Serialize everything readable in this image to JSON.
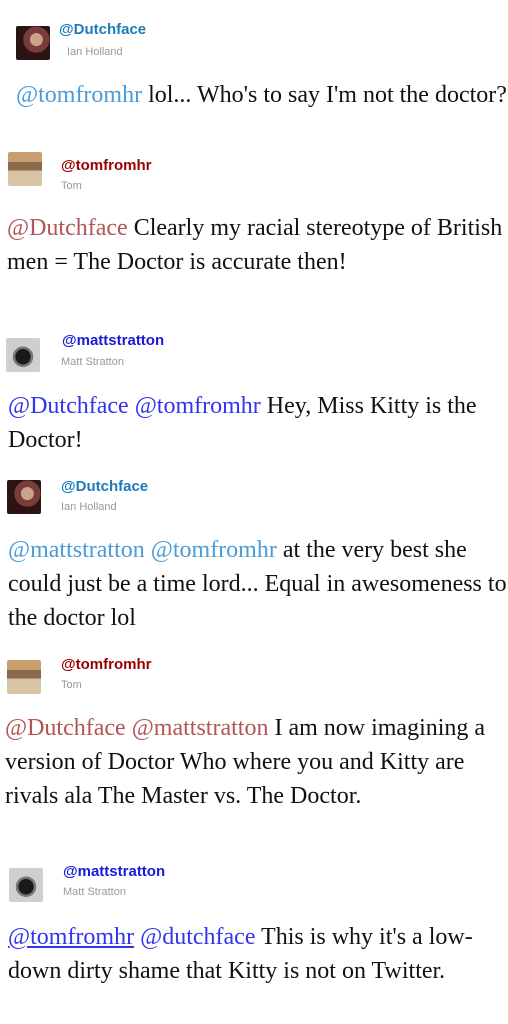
{
  "tweets": [
    {
      "handle": "@Dutchface",
      "name": "Ian Holland",
      "avatar_icon": "avatar-dutchface",
      "handle_color": "#1a7db8",
      "mention_color": "#4a9bd8",
      "parts": [
        {
          "type": "mention",
          "text": "@tomfromhr"
        },
        {
          "type": "text",
          "text": " lol... Who's to say I'm not the doctor?"
        }
      ]
    },
    {
      "handle": "@tomfromhr",
      "name": "Tom",
      "avatar_icon": "avatar-tomfromhr",
      "handle_color": "#990000",
      "mention_color": "#b35555",
      "parts": [
        {
          "type": "mention",
          "text": "@Dutchface"
        },
        {
          "type": "text",
          "text": " Clearly my racial stereotype of British men = The Doctor is accurate then!"
        }
      ]
    },
    {
      "handle": "@mattstratton",
      "name": "Matt Stratton",
      "avatar_icon": "avatar-mattstratton",
      "handle_color": "#1a1ad9",
      "mention_color": "#3333ee",
      "parts": [
        {
          "type": "mention",
          "text": "@Dutchface"
        },
        {
          "type": "text",
          "text": " "
        },
        {
          "type": "mention",
          "text": "@tomfromhr"
        },
        {
          "type": "text",
          "text": " Hey, Miss Kitty is the Doctor!"
        }
      ]
    },
    {
      "handle": "@Dutchface",
      "name": "Ian Holland",
      "avatar_icon": "avatar-dutchface",
      "handle_color": "#1a7db8",
      "mention_color": "#4a9bd8",
      "parts": [
        {
          "type": "mention",
          "text": "@mattstratton"
        },
        {
          "type": "text",
          "text": " "
        },
        {
          "type": "mention",
          "text": "@tomfromhr"
        },
        {
          "type": "text",
          "text": " at the very best she could just be a time lord... Equal in awesomeness to the doctor lol"
        }
      ]
    },
    {
      "handle": "@tomfromhr",
      "name": "Tom",
      "avatar_icon": "avatar-tomfromhr",
      "handle_color": "#990000",
      "mention_color": "#b35555",
      "parts": [
        {
          "type": "mention",
          "text": "@Dutchface"
        },
        {
          "type": "text",
          "text": " "
        },
        {
          "type": "mention",
          "text": "@mattstratton"
        },
        {
          "type": "text",
          "text": " I am now imagining a version of Doctor Who where you and Kitty are rivals ala The Master vs. The Doctor."
        }
      ]
    },
    {
      "handle": "@mattstratton",
      "name": "Matt Stratton",
      "avatar_icon": "avatar-mattstratton",
      "handle_color": "#1a1ad9",
      "mention_color": "#3333ee",
      "parts": [
        {
          "type": "mention",
          "text": "@tomfromhr",
          "underlined": true
        },
        {
          "type": "text",
          "text": " "
        },
        {
          "type": "mention",
          "text": "@dutchface"
        },
        {
          "type": "text",
          "text": " This is why it's a low-down dirty shame that Kitty is not on Twitter."
        }
      ]
    }
  ]
}
